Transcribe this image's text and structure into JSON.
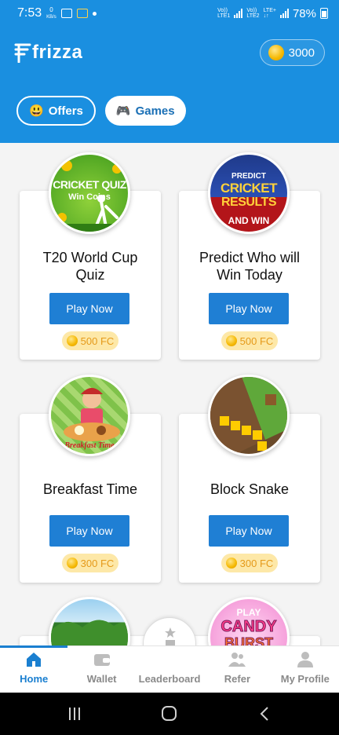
{
  "status_bar": {
    "time": "7:53",
    "speed": "0 KB/s",
    "volte1": "Vo)) LTE1",
    "volte2": "Vo)) LTE2",
    "lte": "LTE+",
    "battery": "78%"
  },
  "app": {
    "name": "frizza",
    "coins": "3000"
  },
  "tabs": [
    {
      "label": "Offers",
      "emoji": "😃"
    },
    {
      "label": "Games",
      "emoji": "🎮"
    }
  ],
  "games": [
    {
      "title": "T20 World Cup Quiz",
      "thumb_text1": "CRICKET QUIZ",
      "thumb_text2": "Win Coins",
      "button": "Play Now",
      "reward": "500 FC"
    },
    {
      "title": "Predict Who will Win Today",
      "thumb_text1": "PREDICT",
      "thumb_text2": "CRICKET",
      "thumb_text3": "RESULTS",
      "thumb_text4": "AND WIN",
      "button": "Play Now",
      "reward": "500 FC"
    },
    {
      "title": "Breakfast Time",
      "thumb_text1": "Breakfast Time",
      "button": "Play Now",
      "reward": "300 FC"
    },
    {
      "title": "Block Snake",
      "button": "Play Now",
      "reward": "300 FC"
    },
    {
      "title": "",
      "button": "",
      "reward": ""
    },
    {
      "title": "",
      "thumb_text1": "PLAY",
      "thumb_text2": "CANDY",
      "thumb_text3": "BURST",
      "button": "",
      "reward": ""
    }
  ],
  "bottom_nav": [
    {
      "label": "Home",
      "icon": "home-icon"
    },
    {
      "label": "Wallet",
      "icon": "wallet-icon"
    },
    {
      "label": "Leaderboard",
      "icon": "leaderboard-icon"
    },
    {
      "label": "Refer",
      "icon": "refer-icon"
    },
    {
      "label": "My Profile",
      "icon": "profile-icon"
    }
  ],
  "colors": {
    "primary": "#1a8fe0",
    "button": "#1f7fd4",
    "reward_bg": "#fde8a8",
    "reward_text": "#e59a1a"
  }
}
